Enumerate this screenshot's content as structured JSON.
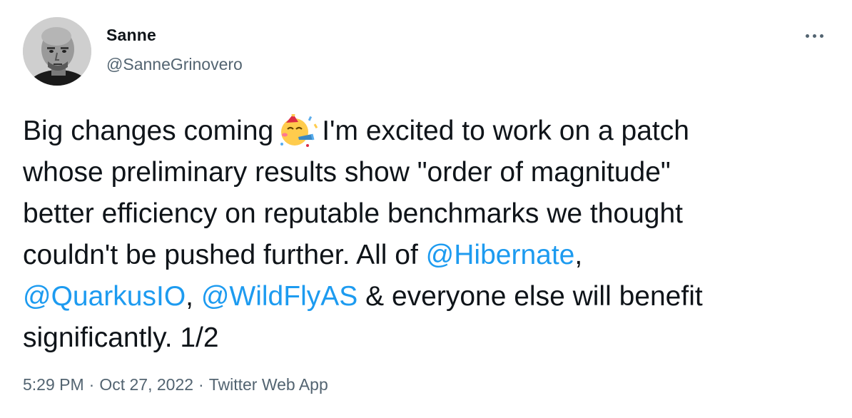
{
  "author": {
    "name": "Sanne",
    "handle": "@SanneGrinovero"
  },
  "tweet": {
    "line1_pre": "Big changes coming",
    "emoji": "party-face-icon",
    "line1_post": "I'm excited to work on a patch",
    "line2": "whose preliminary results show \"order of magnitude\"",
    "line3": "better efficiency on reputable benchmarks we thought",
    "line4_pre": "couldn't be pushed further. All of ",
    "mention1": "@Hibernate",
    "line4_post": ",",
    "mention2": "@QuarkusIO",
    "line5_mid": ", ",
    "mention3": "@WildFlyAS",
    "line5_post": " & everyone else will benefit",
    "line6": "significantly. 1/2"
  },
  "meta": {
    "time": "5:29 PM",
    "date": "Oct 27, 2022",
    "separator": "·",
    "source": "Twitter Web App"
  },
  "colors": {
    "text": "#0f1419",
    "secondary": "#536471",
    "link": "#1d9bf0"
  },
  "icons": {
    "more": "more-options-icon"
  }
}
